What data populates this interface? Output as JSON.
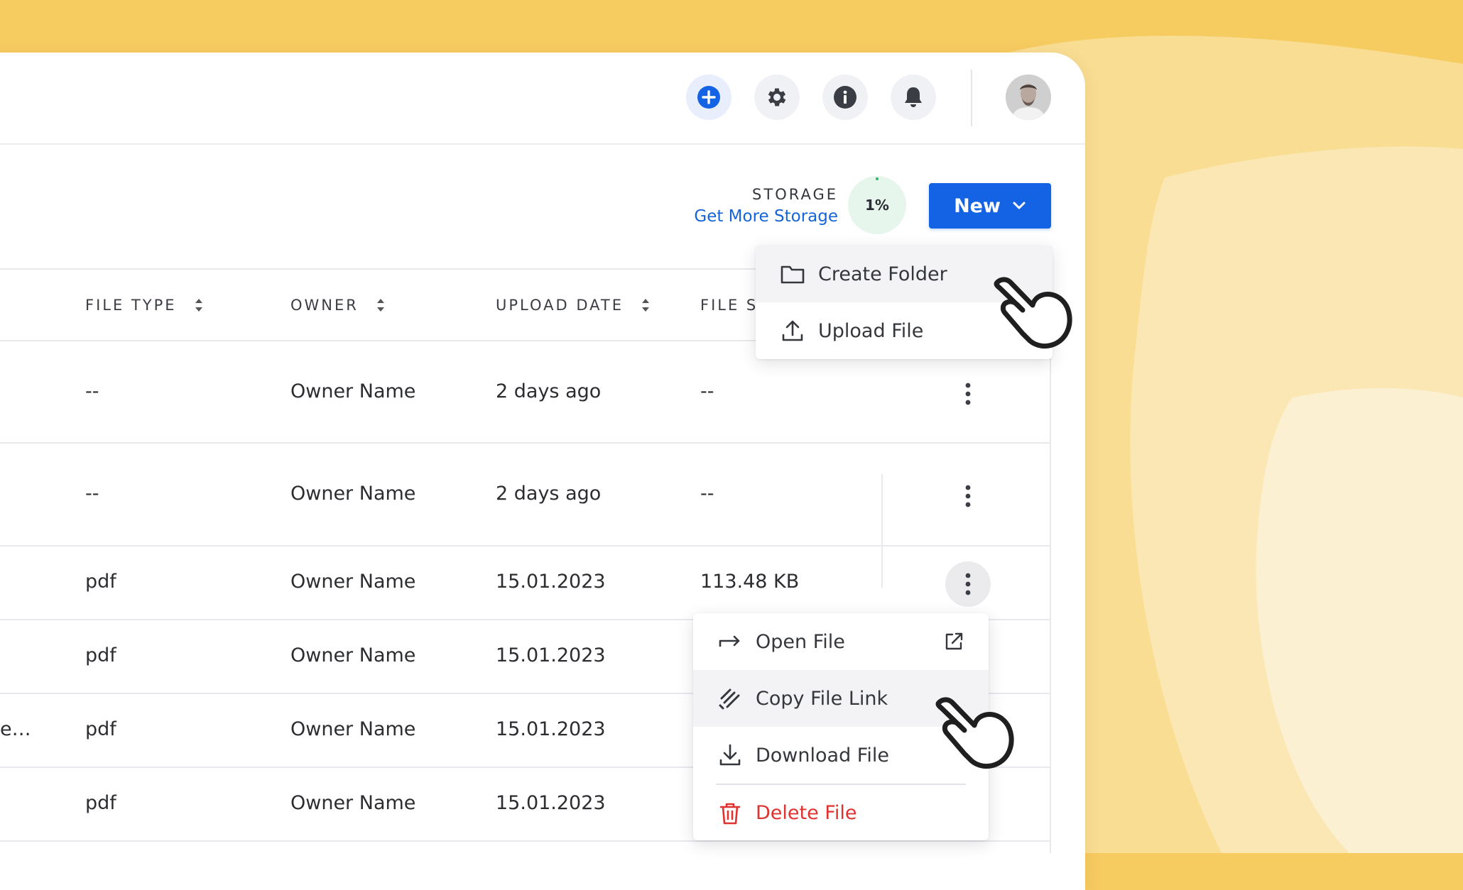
{
  "colors": {
    "background": "#f6cb60",
    "primary": "#1463e5",
    "link": "#1565d8",
    "danger": "#e0322f",
    "storage_ring": "#e6f6ec"
  },
  "topbar": {
    "icons": [
      "plus-circle-icon",
      "gear-icon",
      "info-icon",
      "bell-icon"
    ],
    "avatar": "user-avatar"
  },
  "storage": {
    "label": "STORAGE",
    "link": "Get More Storage",
    "percent": "1%"
  },
  "new_button": {
    "label": "New"
  },
  "new_menu": {
    "items": [
      {
        "label": "Create Folder",
        "icon": "folder-icon"
      },
      {
        "label": "Upload File",
        "icon": "upload-icon"
      }
    ]
  },
  "table": {
    "headers": {
      "file_type": "FILE TYPE",
      "owner": "OWNER",
      "upload_date": "UPLOAD DATE",
      "file_size": "FILE SI"
    },
    "rows": [
      {
        "name": "",
        "file_type": "--",
        "owner": "Owner Name",
        "upload_date": "2 days ago",
        "file_size": "--"
      },
      {
        "name": "",
        "file_type": "--",
        "owner": "Owner Name",
        "upload_date": "2 days ago",
        "file_size": "--"
      },
      {
        "name": "",
        "file_type": "pdf",
        "owner": "Owner Name",
        "upload_date": "15.01.2023",
        "file_size": "113.48 KB"
      },
      {
        "name": "",
        "file_type": "pdf",
        "owner": "Owner Name",
        "upload_date": "15.01.2023",
        "file_size": ""
      },
      {
        "name": "e…",
        "file_type": "pdf",
        "owner": "Owner Name",
        "upload_date": "15.01.2023",
        "file_size": ""
      },
      {
        "name": "",
        "file_type": "pdf",
        "owner": "Owner Name",
        "upload_date": "15.01.2023",
        "file_size": ""
      }
    ]
  },
  "file_menu": {
    "items": [
      {
        "label": "Open File",
        "icon": "arrow-right-icon",
        "trailing_icon": "external-link-icon"
      },
      {
        "label": "Copy File Link",
        "icon": "link-icon"
      },
      {
        "label": "Download File",
        "icon": "download-icon"
      },
      {
        "label": "Delete File",
        "icon": "trash-icon"
      }
    ]
  }
}
